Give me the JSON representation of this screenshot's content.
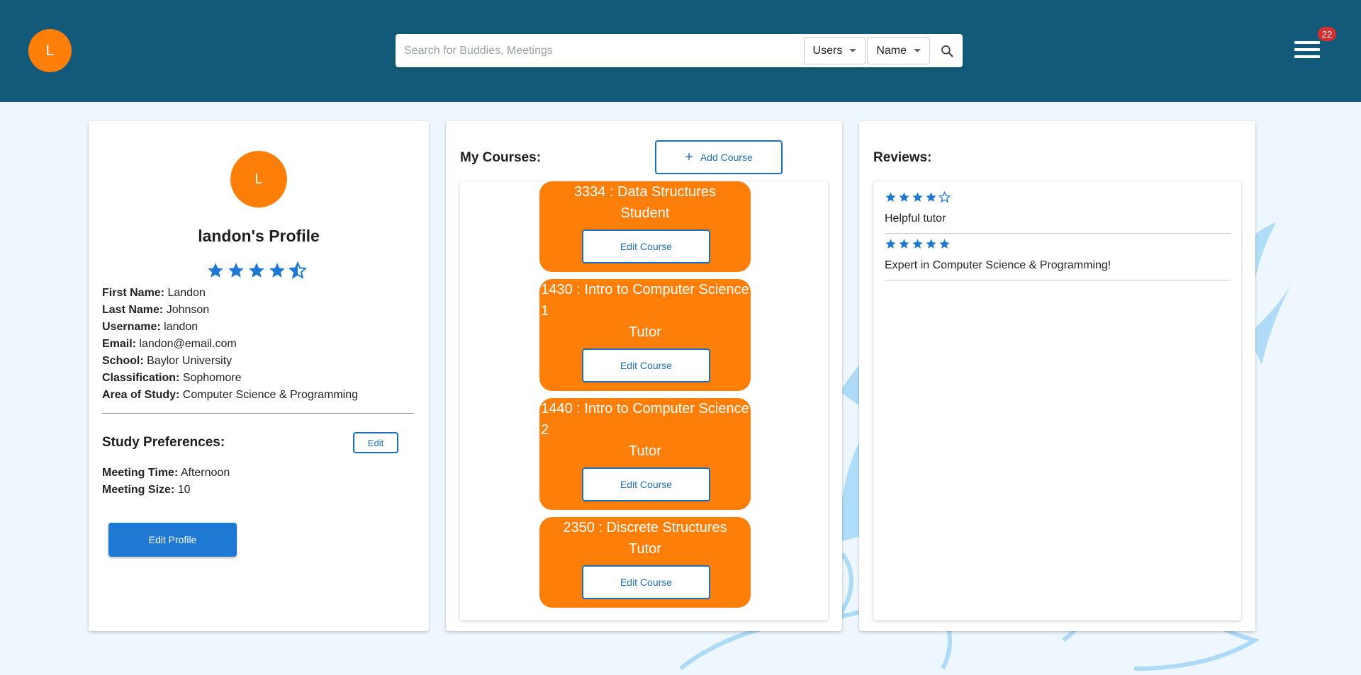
{
  "header": {
    "avatar_initial": "L",
    "search": {
      "placeholder": "Search for Buddies, Meetings",
      "value": "",
      "type_select": "Users",
      "field_select": "Name"
    },
    "notification_count": "22",
    "icons": [
      "search-icon",
      "hamburger-menu-icon"
    ]
  },
  "profile": {
    "avatar_initial": "L",
    "title": "landon's Profile",
    "rating": 4.5,
    "fields": [
      {
        "label": "First Name:",
        "value": "Landon"
      },
      {
        "label": "Last Name:",
        "value": "Johnson"
      },
      {
        "label": "Username:",
        "value": "landon"
      },
      {
        "label": "Email:",
        "value": "landon@email.com"
      },
      {
        "label": "School:",
        "value": "Baylor University"
      },
      {
        "label": "Classification:",
        "value": "Sophomore"
      },
      {
        "label": "Area of Study:",
        "value": "Computer Science & Programming"
      }
    ],
    "study_prefs": {
      "title": "Study Preferences:",
      "edit_label": "Edit",
      "fields": [
        {
          "label": "Meeting Time:",
          "value": "Afternoon"
        },
        {
          "label": "Meeting Size:",
          "value": "10"
        }
      ]
    },
    "edit_profile_label": "Edit Profile"
  },
  "courses": {
    "title": "My Courses:",
    "add_label": "Add Course",
    "edit_label": "Edit Course",
    "items": [
      {
        "line1": "3334 : Data Structures",
        "line2": "",
        "role": "Student"
      },
      {
        "line1": "1430 : Intro to Computer Science",
        "line2": "1",
        "role": "Tutor"
      },
      {
        "line1": "1440 : Intro to Computer Science",
        "line2": "2",
        "role": "Tutor"
      },
      {
        "line1": "2350 : Discrete Structures",
        "line2": "",
        "role": "Tutor"
      }
    ]
  },
  "reviews": {
    "title": "Reviews:",
    "items": [
      {
        "rating": 4,
        "text": "Helpful tutor"
      },
      {
        "rating": 5,
        "text": "Expert in Computer Science & Programming!"
      }
    ]
  },
  "colors": {
    "header_bg": "#135a7a",
    "accent_orange": "#fd7f0a",
    "primary_blue": "#1f78d1",
    "star_blue": "#1f78d1",
    "badge_red": "#d32f2f"
  }
}
